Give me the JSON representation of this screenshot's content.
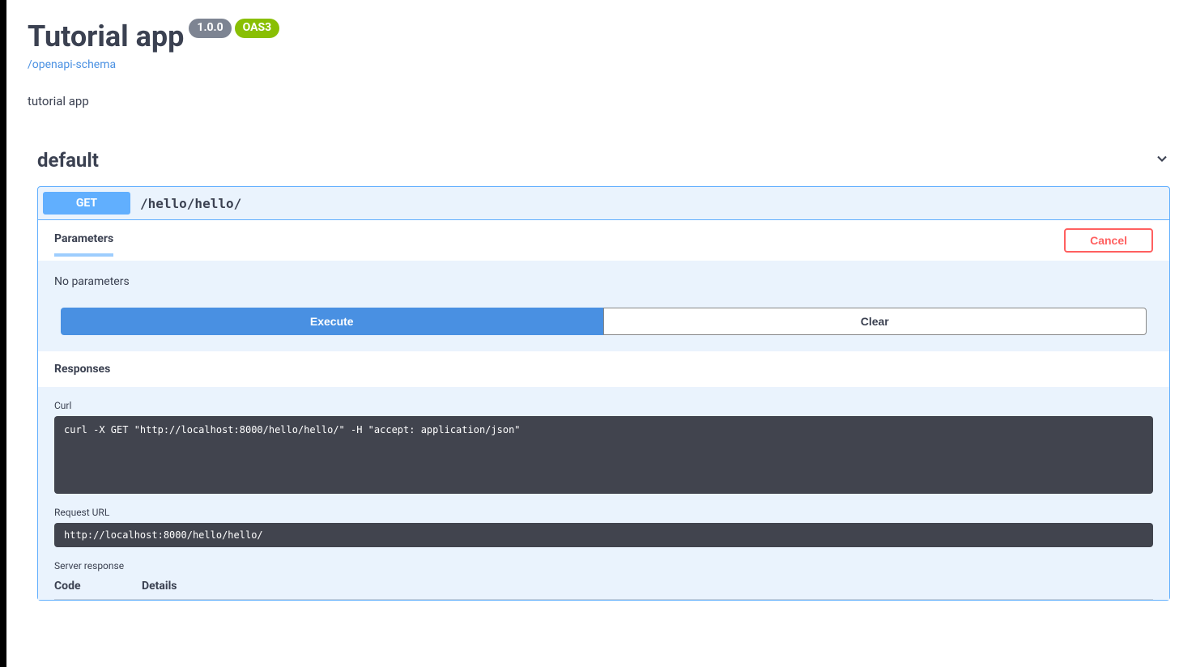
{
  "header": {
    "title": "Tutorial app",
    "version": "1.0.0",
    "oas_tag": "OAS3",
    "schema_link": "/openapi-schema",
    "description": "tutorial app"
  },
  "tag": {
    "name": "default"
  },
  "operation": {
    "method": "GET",
    "path": "/hello/hello/",
    "parameters_tab": "Parameters",
    "cancel_label": "Cancel",
    "no_params_text": "No parameters",
    "execute_label": "Execute",
    "clear_label": "Clear",
    "responses_label": "Responses"
  },
  "response": {
    "curl_label": "Curl",
    "curl_command": "curl -X GET \"http://localhost:8000/hello/hello/\" -H \"accept: application/json\"",
    "request_url_label": "Request URL",
    "request_url": "http://localhost:8000/hello/hello/",
    "server_response_label": "Server response",
    "code_col": "Code",
    "details_col": "Details"
  }
}
